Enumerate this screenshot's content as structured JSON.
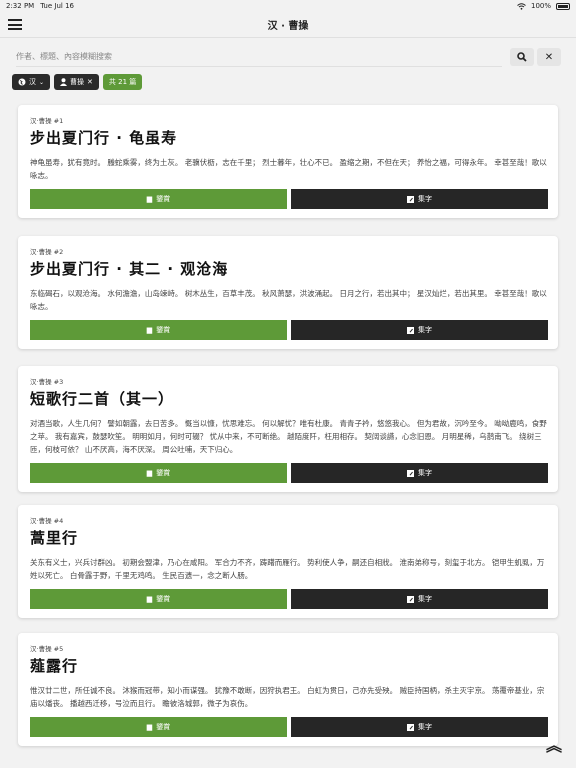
{
  "status": {
    "time": "2:32 PM",
    "date": "Tue Jul 16",
    "battery": "100%"
  },
  "nav": {
    "title": "汉 · 曹操"
  },
  "search": {
    "placeholder": "作者、標題、內容模糊搜索"
  },
  "filters": {
    "dynasty": "汉",
    "author": "曹操",
    "count": "共 21 篇"
  },
  "actions": {
    "appreciate": "鑒賞",
    "collect": "集字"
  },
  "poems": [
    {
      "dynasty": "汉·曹操 #1",
      "title": "步出夏门行 · 龟虽寿",
      "excerpt": "神龟虽寿，犹有竟时。 螣蛇乘雾，终为土灰。 老骥伏枥，志在千里； 烈士暮年，壮心不已。 盈缩之期，不但在天； 养怡之福，可得永年。 幸甚至哉！歌以咏志。"
    },
    {
      "dynasty": "汉·曹操 #2",
      "title": "步出夏门行 · 其二 · 观沧海",
      "excerpt": "东临碣石，以观沧海。 水何澹澹，山岛竦峙。 树木丛生，百草丰茂。 秋风萧瑟，洪波涌起。 日月之行，若出其中； 星汉灿烂，若出其里。 幸甚至哉！歌以咏志。"
    },
    {
      "dynasty": "汉·曹操 #3",
      "title": "短歌行二首（其一）",
      "excerpt": "对酒当歌，人生几何？ 譬如朝露，去日苦多。 慨当以慷，忧思难忘。 何以解忧？唯有杜康。 青青子衿，悠悠我心。 但为君故，沉吟至今。 呦呦鹿鸣，食野之苹。 我有嘉宾，鼓瑟吹笙。 明明如月，何时可辍？ 忧从中来，不可断绝。 越陌度阡，枉用相存。 契阔谈讌，心念旧恩。 月明星稀，乌鹊南飞。 绕树三匝，何枝可依？ 山不厌高，海不厌深。 周公吐哺，天下归心。"
    },
    {
      "dynasty": "汉·曹操 #4",
      "title": "蒿里行",
      "excerpt": "关东有义士，兴兵讨群凶。 初期会盟津，乃心在咸阳。 军合力不齐，踌躇而雁行。 势利使人争，嗣还自相戕。 淮南弟称号，刻玺于北方。 铠甲生虮虱，万姓以死亡。 白骨露于野，千里无鸡鸣。 生民百遗一，念之断人肠。"
    },
    {
      "dynasty": "汉·曹操 #5",
      "title": "薤露行",
      "excerpt": "惟汉廿二世，所任诚不良。 沐猴而冠带，知小而谋强。 犹豫不敢断，因狩执君王。 白虹为贯日，己亦先受殃。 贼臣持国柄，杀主灭宇京。 荡覆帝基业，宗庙以燔丧。 播越西迁移，号泣而且行。 瞻彼洛城郭，微子为哀伤。"
    }
  ],
  "icons": {
    "menu": "hamburger-icon",
    "search": "search-icon",
    "clear": "close-icon",
    "globe": "globe-icon",
    "user": "user-icon",
    "appreciate": "book-icon",
    "collect": "edit-icon",
    "top": "double-chevron-up-icon"
  }
}
